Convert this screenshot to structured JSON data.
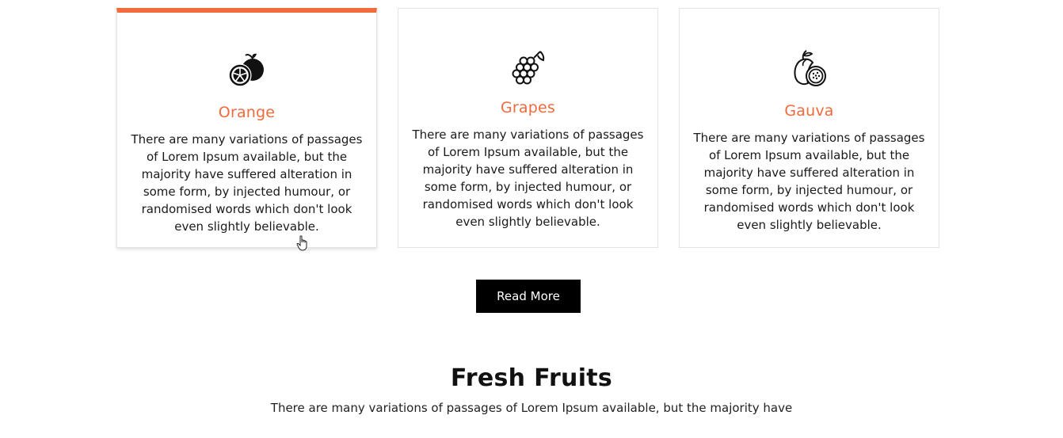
{
  "cards": [
    {
      "icon": "orange-icon",
      "title": "Orange",
      "text": "There are many variations of passages of Lorem Ipsum available, but the majority have suffered alteration in some form, by injected humour, or randomised words which don't look even slightly believable.",
      "active": true
    },
    {
      "icon": "grapes-icon",
      "title": "Grapes",
      "text": "There are many variations of passages of Lorem Ipsum available, but the majority have suffered alteration in some form, by injected humour, or randomised words which don't look even slightly believable.",
      "active": false
    },
    {
      "icon": "guava-icon",
      "title": "Gauva",
      "text": "There are many variations of passages of Lorem Ipsum available, but the majority have suffered alteration in some form, by injected humour, or randomised words which don't look even slightly believable.",
      "active": false
    }
  ],
  "read_more_label": "Read More",
  "section": {
    "title": "Fresh Fruits",
    "text": "There are many variations of passages of Lorem Ipsum available, but the majority have"
  },
  "colors": {
    "accent": "#f26b3a",
    "title": "#f06a3b",
    "button_bg": "#000000",
    "button_text": "#ffffff"
  }
}
